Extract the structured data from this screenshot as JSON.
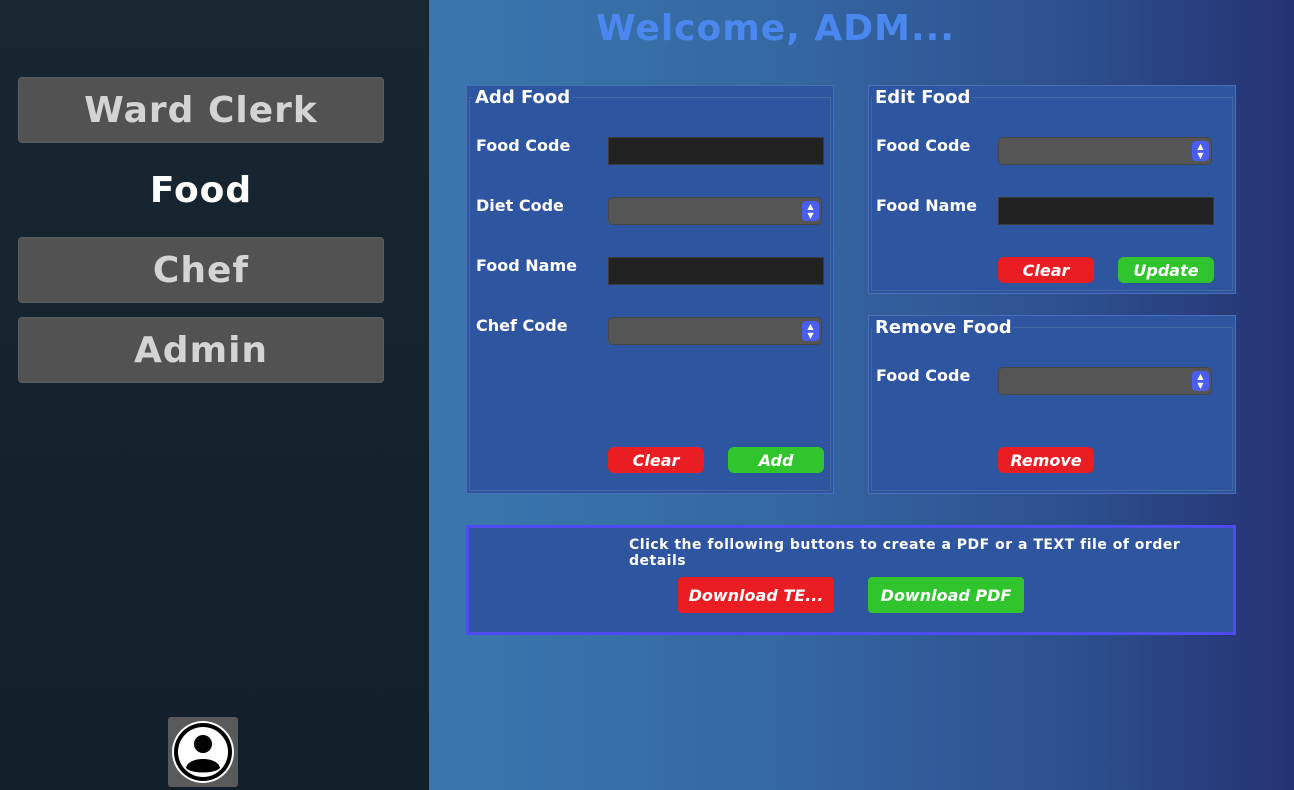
{
  "sidebar": {
    "items": [
      {
        "label": "Ward Clerk"
      },
      {
        "label": "Food"
      },
      {
        "label": "Chef"
      },
      {
        "label": "Admin"
      }
    ],
    "avatar_icon": "user-circle-icon"
  },
  "header": {
    "welcome": "Welcome, ADM..."
  },
  "add_food": {
    "title": "Add Food",
    "food_code_label": "Food Code",
    "diet_code_label": "Diet Code",
    "food_name_label": "Food Name",
    "chef_code_label": "Chef Code",
    "food_code_value": "",
    "food_name_value": "",
    "diet_code_selected": "",
    "chef_code_selected": "",
    "clear_label": "Clear",
    "add_label": "Add"
  },
  "edit_food": {
    "title": "Edit Food",
    "food_code_label": "Food Code",
    "food_name_label": "Food Name",
    "food_code_selected": "",
    "food_name_value": "",
    "clear_label": "Clear",
    "update_label": "Update"
  },
  "remove_food": {
    "title": "Remove Food",
    "food_code_label": "Food Code",
    "food_code_selected": "",
    "remove_label": "Remove"
  },
  "download": {
    "instructions": "Click the following buttons to create a PDF or a TEXT file of order details",
    "text_label": "Download TE...",
    "pdf_label": "Download PDF"
  },
  "colors": {
    "accent_red": "#ea1d23",
    "accent_green": "#30c52c",
    "panel_blue": "#2e55a0",
    "welcome_blue": "#4a88f0"
  }
}
